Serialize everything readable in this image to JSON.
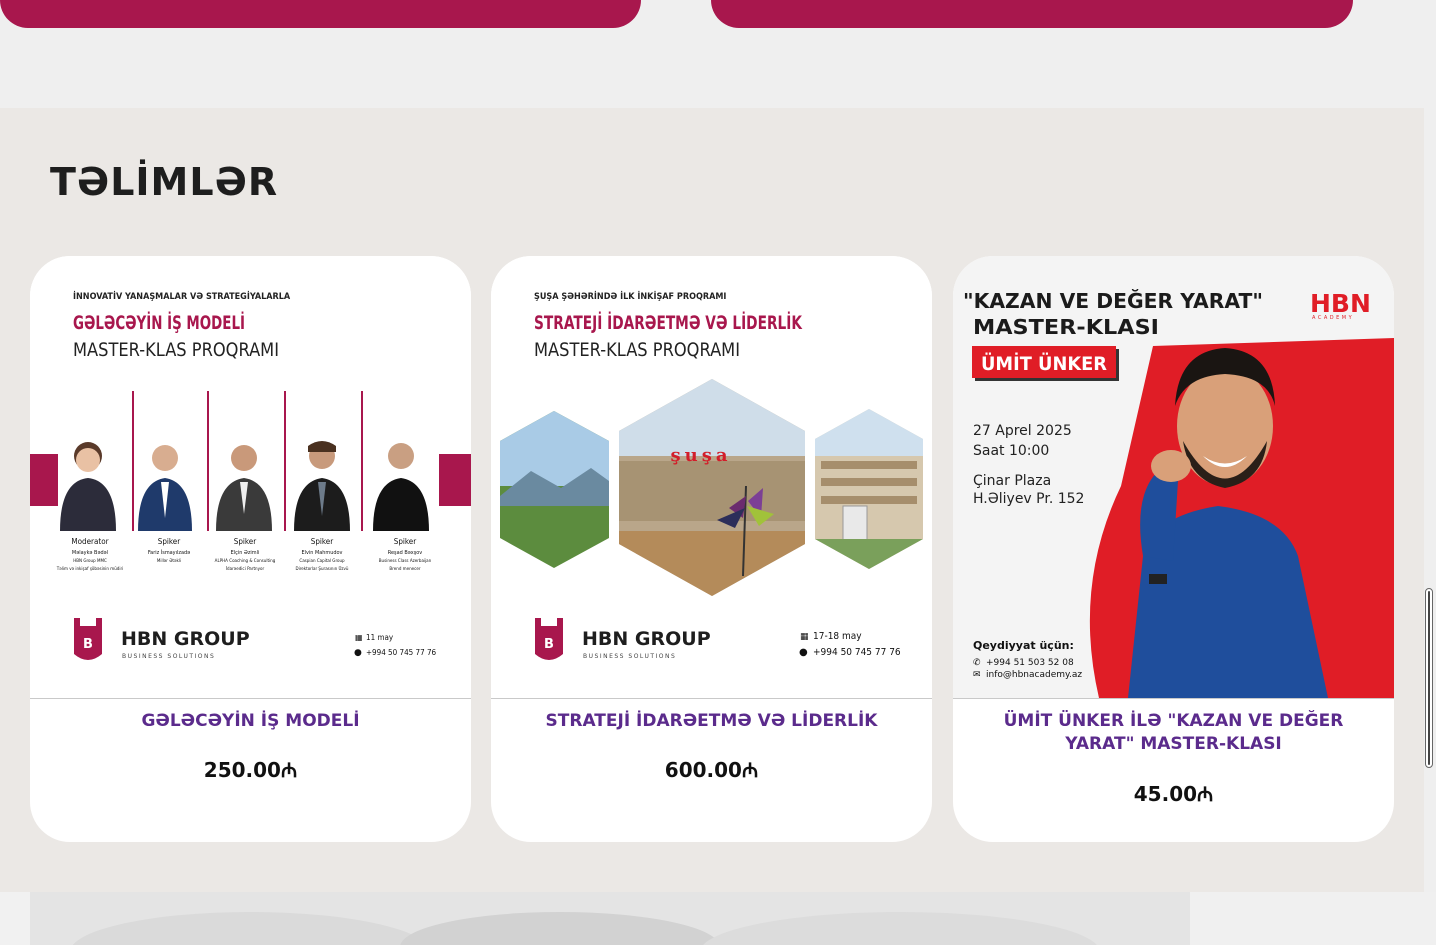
{
  "section": {
    "title": "TƏLİMLƏR"
  },
  "currency_symbol": "₼",
  "trainings": [
    {
      "title": "GƏLƏCƏYİN İŞ MODELİ",
      "price": "250.00₼",
      "poster": {
        "kicker": "İNNOVATİV YANAŞMALAR VƏ STRATEGİYALARLA",
        "headline": "GƏLƏCƏYİN İŞ MODELİ",
        "subhead": "MASTER-KLAS PROQRAMI",
        "people": [
          {
            "role": "Moderator",
            "name": "Məlaykə Bədəl",
            "org": "HBN Group MMC",
            "org2": "Təlim və inkişaf şöbəsinin müdiri"
          },
          {
            "role": "Spiker",
            "name": "Fariz İsmayılzadə",
            "org": "Millər Ətəkli",
            "org2": ""
          },
          {
            "role": "Spiker",
            "name": "Elçin Əzimli",
            "org": "ALPHA Coaching & Consulting",
            "org2": "İdarəedici Partnyor"
          },
          {
            "role": "Spiker",
            "name": "Elvin Mahmudov",
            "org": "Caspian Capital Group",
            "org2": "Direktorlar Şurasının Üzvü"
          },
          {
            "role": "Spiker",
            "name": "Reşad Bəxşov",
            "org": "Business Class Azerbaijan",
            "org2": "Brend menecer"
          }
        ],
        "brand": "HBN GROUP",
        "brand_sub": "BUSINESS SOLUTIONS",
        "date": "11 may",
        "phone": "+994 50 745 77 76"
      }
    },
    {
      "title": "STRATEJİ İDARƏETMƏ VƏ LİDERLİK",
      "price": "600.00₼",
      "poster": {
        "kicker": "ŞUŞA ŞƏHƏRİNDƏ İLK İNKİŞAF PROQRAMI",
        "headline": "STRATEJİ İDARƏETMƏ VƏ LİDERLİK",
        "subhead": "MASTER-KLAS PROQRAMI",
        "sign": "şuşa",
        "brand": "HBN GROUP",
        "brand_sub": "BUSINESS SOLUTIONS",
        "date": "17-18 may",
        "phone": "+994 50 745 77 76"
      }
    },
    {
      "title": "ÜMİT ÜNKER İLƏ \"KAZAN VE DEĞER YARAT\" MASTER-KLASI",
      "price": "45.00₼",
      "poster": {
        "headline1": "\"KAZAN VE DEĞER YARAT\"",
        "headline2": "MASTER-KLASI",
        "speaker": "ÜMİT ÜNKER",
        "date": "27 Aprel 2025",
        "time": "Saat 10:00",
        "venue": "Çinar Plaza",
        "address": "H.Əliyev Pr. 152",
        "reg_label": "Qeydiyyat üçün:",
        "phone": "+994 51 503 52 08",
        "email": "info@hbnacademy.az",
        "logo": "HBN",
        "logo_sub": "ACADEMY"
      }
    }
  ],
  "colors": {
    "brand": "#a8174d",
    "title_purple": "#5b2b8c",
    "section_bg": "#ebe8e5"
  }
}
